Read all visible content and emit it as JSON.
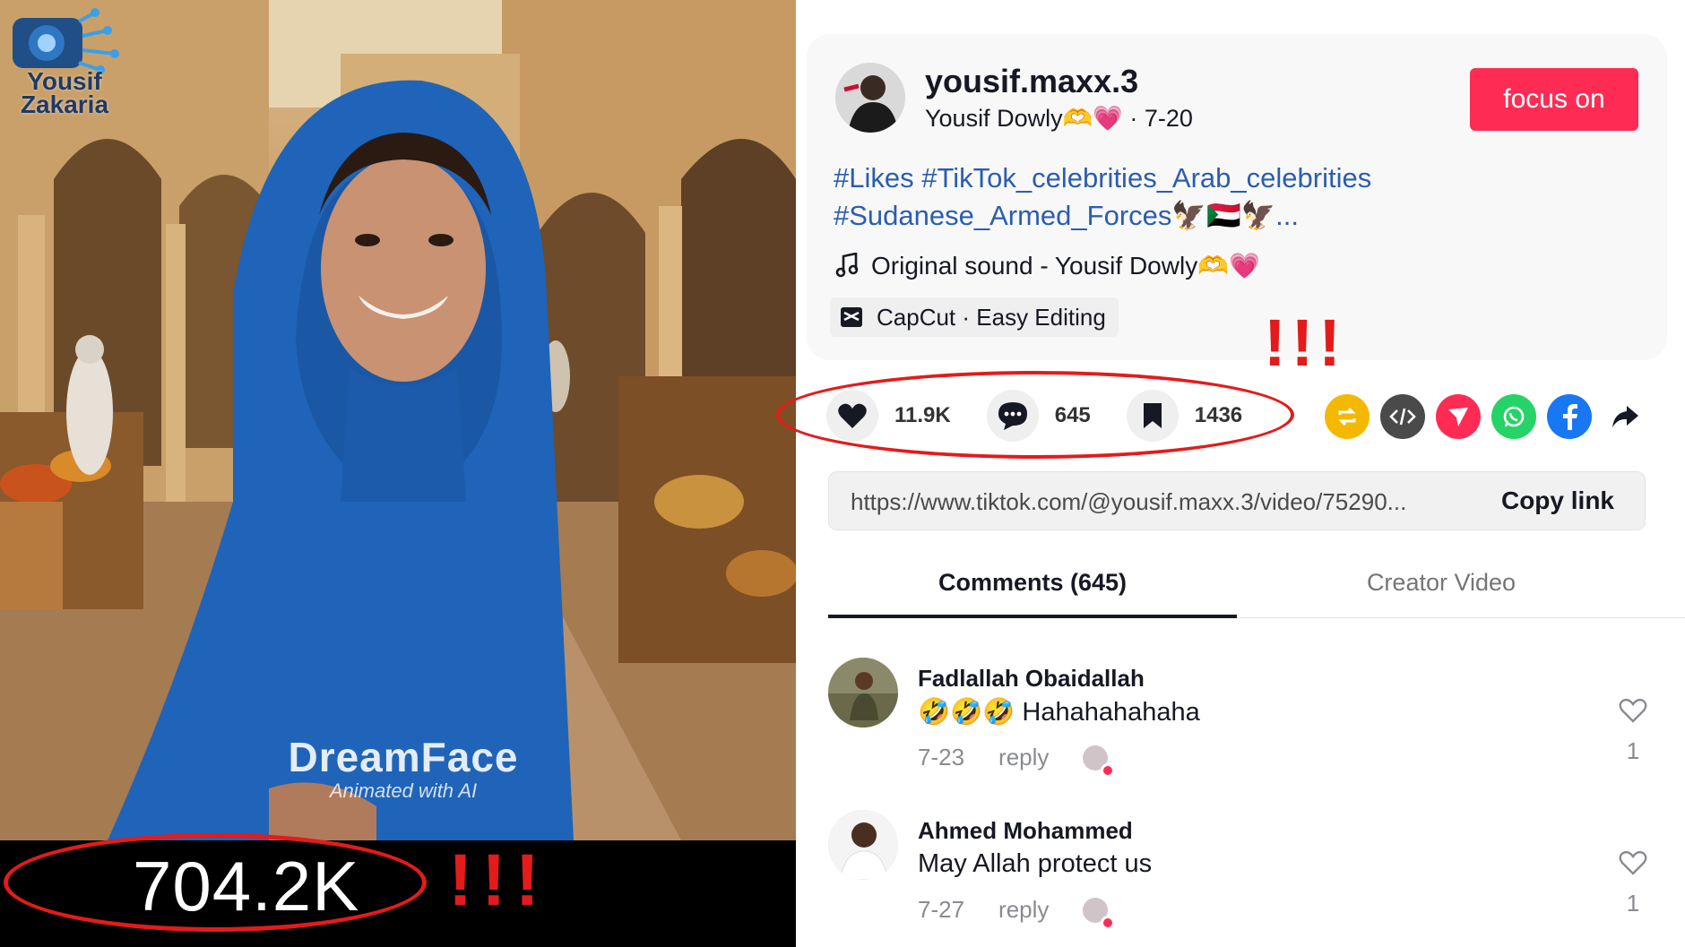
{
  "video": {
    "watermark": "Yousif Zakaria",
    "brand": "DreamFace",
    "brand_sub": "Animated with AI",
    "views": "704.2K",
    "annotation": "!!!"
  },
  "post": {
    "username": "yousif.maxx.3",
    "display_name": "Yousif Dowly🫶💗",
    "date": "· 7-20",
    "follow_label": "focus on",
    "hashtags": [
      "#Likes",
      "#TikTok_celebrities_Arab_celebrities",
      "#Sudanese_Armed_Forces🦅🇸🇩🦅..."
    ],
    "sound": "Original sound - Yousif Dowly🫶💗",
    "capcut": "CapCut · Easy Editing",
    "annotation": "!!!"
  },
  "stats": {
    "likes": "11.9K",
    "comments": "645",
    "saves": "1436"
  },
  "share": {
    "icons": [
      "repost-icon",
      "embed-icon",
      "send-icon",
      "whatsapp-icon",
      "facebook-icon",
      "share-arrow-icon"
    ],
    "colors": {
      "repost": "#f5b800",
      "embed": "#4a4a4a",
      "send": "#fe2c55",
      "whatsapp": "#25d366",
      "facebook": "#1877f2"
    }
  },
  "link": {
    "url": "https://www.tiktok.com/@yousif.maxx.3/video/75290...",
    "copy_label": "Copy link"
  },
  "tabs": {
    "comments": "Comments (645)",
    "creator": "Creator Video"
  },
  "comments": [
    {
      "name": "Fadlallah Obaidallah",
      "text": "🤣🤣🤣 Hahahahahaha",
      "date": "7-23",
      "reply": "reply",
      "likes": "1"
    },
    {
      "name": "Ahmed Mohammed",
      "text": "May Allah protect us",
      "date": "7-27",
      "reply": "reply",
      "likes": "1"
    }
  ],
  "colors": {
    "accent": "#fe2c55",
    "hashtag": "#2b5db0",
    "annotation_red": "#e31b1b"
  }
}
